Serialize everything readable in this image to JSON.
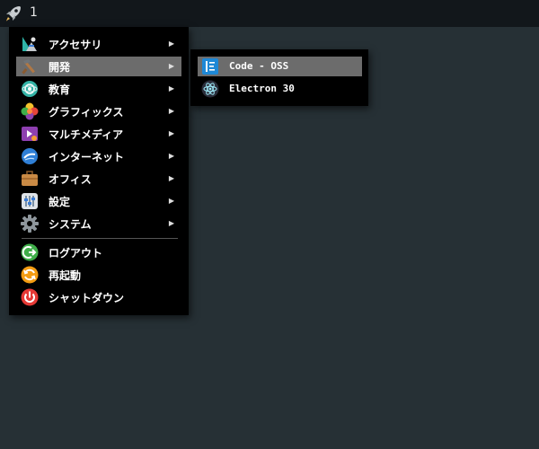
{
  "panel": {
    "launcher_icon": "rocket-icon",
    "workspace_label": "1"
  },
  "menu": {
    "items": [
      {
        "label": "アクセサリ",
        "icon": "accessories-icon",
        "arrow": "▶"
      },
      {
        "label": "開発",
        "icon": "development-icon",
        "arrow": "▶"
      },
      {
        "label": "教育",
        "icon": "education-icon",
        "arrow": "▶"
      },
      {
        "label": "グラフィックス",
        "icon": "graphics-icon",
        "arrow": "▶"
      },
      {
        "label": "マルチメディア",
        "icon": "multimedia-icon",
        "arrow": "▶"
      },
      {
        "label": "インターネット",
        "icon": "internet-icon",
        "arrow": "▶"
      },
      {
        "label": "オフィス",
        "icon": "office-icon",
        "arrow": "▶"
      },
      {
        "label": "設定",
        "icon": "settings-icon",
        "arrow": "▶"
      },
      {
        "label": "システム",
        "icon": "system-icon",
        "arrow": "▶"
      }
    ],
    "actions": [
      {
        "label": "ログアウト",
        "icon": "logout-icon"
      },
      {
        "label": "再起動",
        "icon": "reboot-icon"
      },
      {
        "label": "シャットダウン",
        "icon": "shutdown-icon"
      }
    ],
    "active_index": 1
  },
  "submenu": {
    "items": [
      {
        "label": "Code - OSS",
        "icon": "vscode-icon"
      },
      {
        "label": "Electron 30",
        "icon": "electron-icon"
      }
    ],
    "active_index": 0
  },
  "colors": {
    "desktop": "#263035",
    "panel": "#12171b",
    "menu_bg": "#000000",
    "highlight": "#6c6c6c"
  }
}
